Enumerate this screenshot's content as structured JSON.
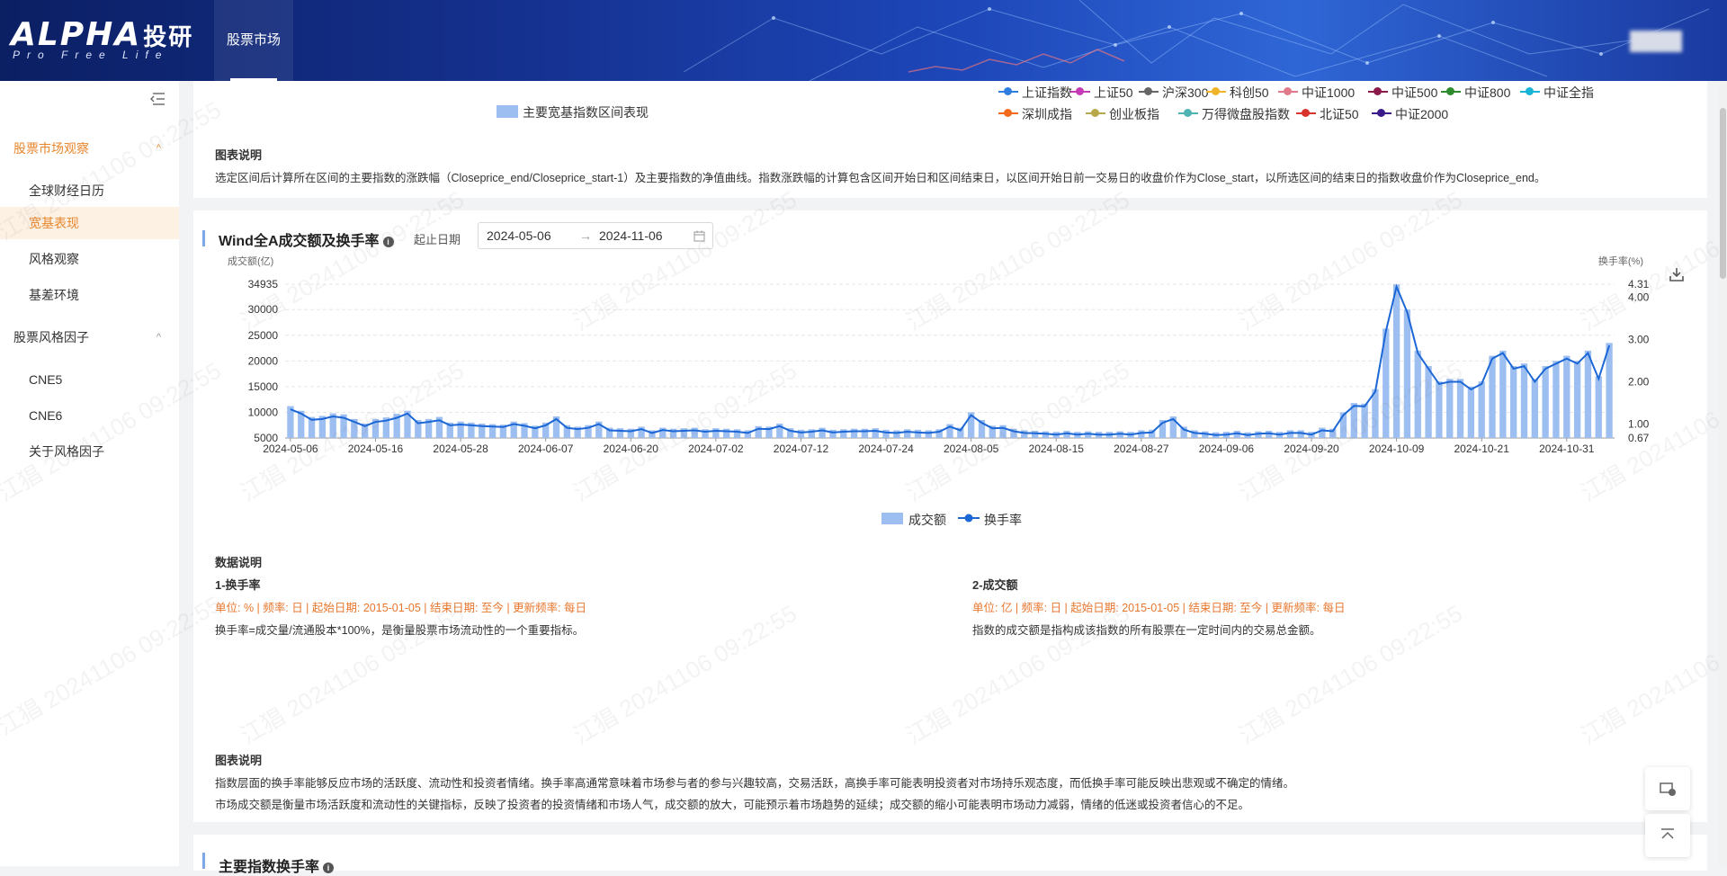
{
  "header": {
    "logo": "ALPHA",
    "logo_cn": "投研",
    "logo_sub": "Pro Free Life",
    "nav_tab": "股票市场"
  },
  "sidebar": {
    "groups": [
      {
        "label": "股票市场观察",
        "caret": "^",
        "items": [
          "全球财经日历",
          "宽基表现",
          "风格观察",
          "基差环境"
        ]
      },
      {
        "label": "股票风格因子",
        "caret": "^",
        "items": [
          "CNE5",
          "CNE6",
          "关于风格因子"
        ]
      }
    ],
    "active_item": "宽基表现"
  },
  "top_card": {
    "legend_bar_label": "主要宽基指数区间表现",
    "legend_lines": [
      {
        "name": "上证指数",
        "color": "#2f7de1"
      },
      {
        "name": "上证50",
        "color": "#c43bb5"
      },
      {
        "name": "沪深300",
        "color": "#666666"
      },
      {
        "name": "科创50",
        "color": "#f0b429"
      },
      {
        "name": "中证1000",
        "color": "#e07a8a"
      },
      {
        "name": "中证500",
        "color": "#8b1a4a"
      },
      {
        "name": "中证800",
        "color": "#2e8b2e"
      },
      {
        "name": "中证全指",
        "color": "#18b5d6"
      },
      {
        "name": "深圳成指",
        "color": "#f26b1d"
      },
      {
        "name": "创业板指",
        "color": "#b8a84a"
      },
      {
        "name": "万得微盘股指数",
        "color": "#4fb3b3"
      },
      {
        "name": "北证50",
        "color": "#d8342c"
      },
      {
        "name": "中证2000",
        "color": "#3b1a8a"
      }
    ],
    "explain_title": "图表说明",
    "explain_text": "选定区间后计算所在区间的主要指数的涨跌幅（Closeprice_end/Closeprice_start-1）及主要指数的净值曲线。指数涨跌幅的计算包含区间开始日和区间结束日，以区间开始日前一交易日的收盘价作为Close_start，以所选区间的结束日的指数收盘价作为Closeprice_end。"
  },
  "chart_card": {
    "title": "Wind全A成交额及换手率",
    "info_icon": "i",
    "date_label": "起止日期",
    "start_date": "2024-05-06",
    "end_date": "2024-11-06",
    "arrow": "→",
    "left_axis_title": "成交额(亿)",
    "right_axis_title": "换手率(%)",
    "legend_bar": "成交额",
    "legend_line": "换手率",
    "data_title": "数据说明",
    "d1_title": "1-换手率",
    "d1_meta": "单位: %  |  频率: 日  |  起始日期: 2015-01-05  |  结束日期: 至今  |  更新频率: 每日",
    "d1_text": "换手率=成交量/流通股本*100%，是衡量股票市场流动性的一个重要指标。",
    "d2_title": "2-成交额",
    "d2_meta": "单位: 亿  |  频率: 日  |  起始日期: 2015-01-05  |  结束日期: 至今  |  更新频率: 每日",
    "d2_text": "指数的成交额是指构成该指数的所有股票在一定时间内的交易总金额。",
    "explain_title": "图表说明",
    "explain_1": "指数层面的换手率能够反应市场的活跃度、流动性和投资者情绪。换手率高通常意味着市场参与者的参与兴趣较高，交易活跃，高换手率可能表明投资者对市场持乐观态度，而低换手率可能反映出悲观或不确定的情绪。",
    "explain_2": "市场成交额是衡量市场活跃度和流动性的关键指标，反映了投资者的投资情绪和市场人气，成交额的放大，可能预示着市场趋势的延续；成交额的缩小可能表明市场动力减弱，情绪的低迷或投资者信心的不足。"
  },
  "next_card": {
    "title": "主要指数换手率"
  },
  "watermark": "江猖 20241106 09:22:55",
  "chart_data": {
    "type": "bar",
    "title": "Wind全A成交额及换手率",
    "ylabel": "成交额(亿)",
    "y2label": "换手率(%)",
    "y_ticks": [
      5000,
      10000,
      15000,
      20000,
      25000,
      30000,
      34935
    ],
    "ylim": [
      5000,
      34935
    ],
    "y2_ticks": [
      0.67,
      1.0,
      2.0,
      3.0,
      4.0,
      4.31
    ],
    "y2lim": [
      0.67,
      4.31
    ],
    "x_ticks": [
      "2024-05-06",
      "2024-05-16",
      "2024-05-28",
      "2024-06-07",
      "2024-06-20",
      "2024-07-02",
      "2024-07-12",
      "2024-07-24",
      "2024-08-05",
      "2024-08-15",
      "2024-08-27",
      "2024-09-06",
      "2024-09-20",
      "2024-10-09",
      "2024-10-21",
      "2024-10-31"
    ],
    "x_tick_index": [
      0,
      8,
      16,
      24,
      32,
      40,
      48,
      56,
      64,
      72,
      80,
      88,
      96,
      104,
      112,
      120
    ],
    "series": [
      {
        "name": "成交额",
        "type": "bar",
        "color": "#9dbef0",
        "values": [
          11200,
          10300,
          9100,
          9300,
          9800,
          9600,
          8700,
          7800,
          8700,
          9000,
          9700,
          10300,
          8500,
          8700,
          9100,
          8000,
          8200,
          8000,
          7800,
          7700,
          7600,
          8200,
          7900,
          7400,
          8000,
          9200,
          7500,
          7200,
          7500,
          8200,
          7000,
          6900,
          6800,
          7200,
          6500,
          7000,
          6800,
          6900,
          7000,
          6700,
          6900,
          6800,
          6700,
          6500,
          7300,
          7200,
          7800,
          6900,
          6600,
          6700,
          7000,
          6600,
          6700,
          6800,
          6800,
          6900,
          6600,
          6500,
          6700,
          6600,
          6500,
          6700,
          7700,
          7000,
          10000,
          8500,
          7400,
          7500,
          6800,
          6500,
          6400,
          6300,
          6200,
          6400,
          6200,
          6300,
          6200,
          6200,
          6300,
          6200,
          6500,
          6600,
          8500,
          9200,
          7200,
          6500,
          6300,
          6100,
          6200,
          6400,
          6100,
          6300,
          6400,
          6200,
          6500,
          6500,
          6200,
          7000,
          6800,
          10000,
          11800,
          11700,
          14500,
          26300,
          34900,
          30000,
          22000,
          19000,
          16000,
          16500,
          16500,
          15000,
          16000,
          21000,
          22000,
          19000,
          19500,
          16500,
          19000,
          20000,
          21000,
          20000,
          22000,
          17000,
          23500
        ]
      },
      {
        "name": "换手率",
        "type": "line",
        "color": "#1c67d6",
        "values": [
          1.35,
          1.25,
          1.1,
          1.12,
          1.18,
          1.15,
          1.05,
          0.95,
          1.05,
          1.08,
          1.15,
          1.25,
          1.02,
          1.05,
          1.09,
          0.97,
          0.99,
          0.97,
          0.95,
          0.94,
          0.93,
          1.0,
          0.96,
          0.9,
          0.97,
          1.12,
          0.91,
          0.88,
          0.91,
          1.0,
          0.85,
          0.84,
          0.83,
          0.88,
          0.79,
          0.86,
          0.83,
          0.84,
          0.85,
          0.82,
          0.84,
          0.83,
          0.82,
          0.79,
          0.89,
          0.88,
          0.95,
          0.84,
          0.8,
          0.82,
          0.85,
          0.8,
          0.82,
          0.83,
          0.83,
          0.84,
          0.8,
          0.79,
          0.82,
          0.8,
          0.79,
          0.82,
          0.94,
          0.85,
          1.21,
          1.03,
          0.9,
          0.91,
          0.83,
          0.79,
          0.78,
          0.77,
          0.75,
          0.78,
          0.75,
          0.77,
          0.75,
          0.75,
          0.77,
          0.75,
          0.79,
          0.8,
          1.03,
          1.12,
          0.87,
          0.79,
          0.77,
          0.74,
          0.75,
          0.78,
          0.74,
          0.77,
          0.78,
          0.75,
          0.79,
          0.79,
          0.75,
          0.85,
          0.83,
          1.21,
          1.43,
          1.42,
          1.77,
          3.2,
          4.25,
          3.65,
          2.68,
          2.31,
          1.95,
          2.0,
          2.0,
          1.82,
          1.95,
          2.55,
          2.68,
          2.31,
          2.37,
          2.0,
          2.31,
          2.43,
          2.55,
          2.43,
          2.68,
          2.07,
          2.86
        ]
      }
    ]
  }
}
